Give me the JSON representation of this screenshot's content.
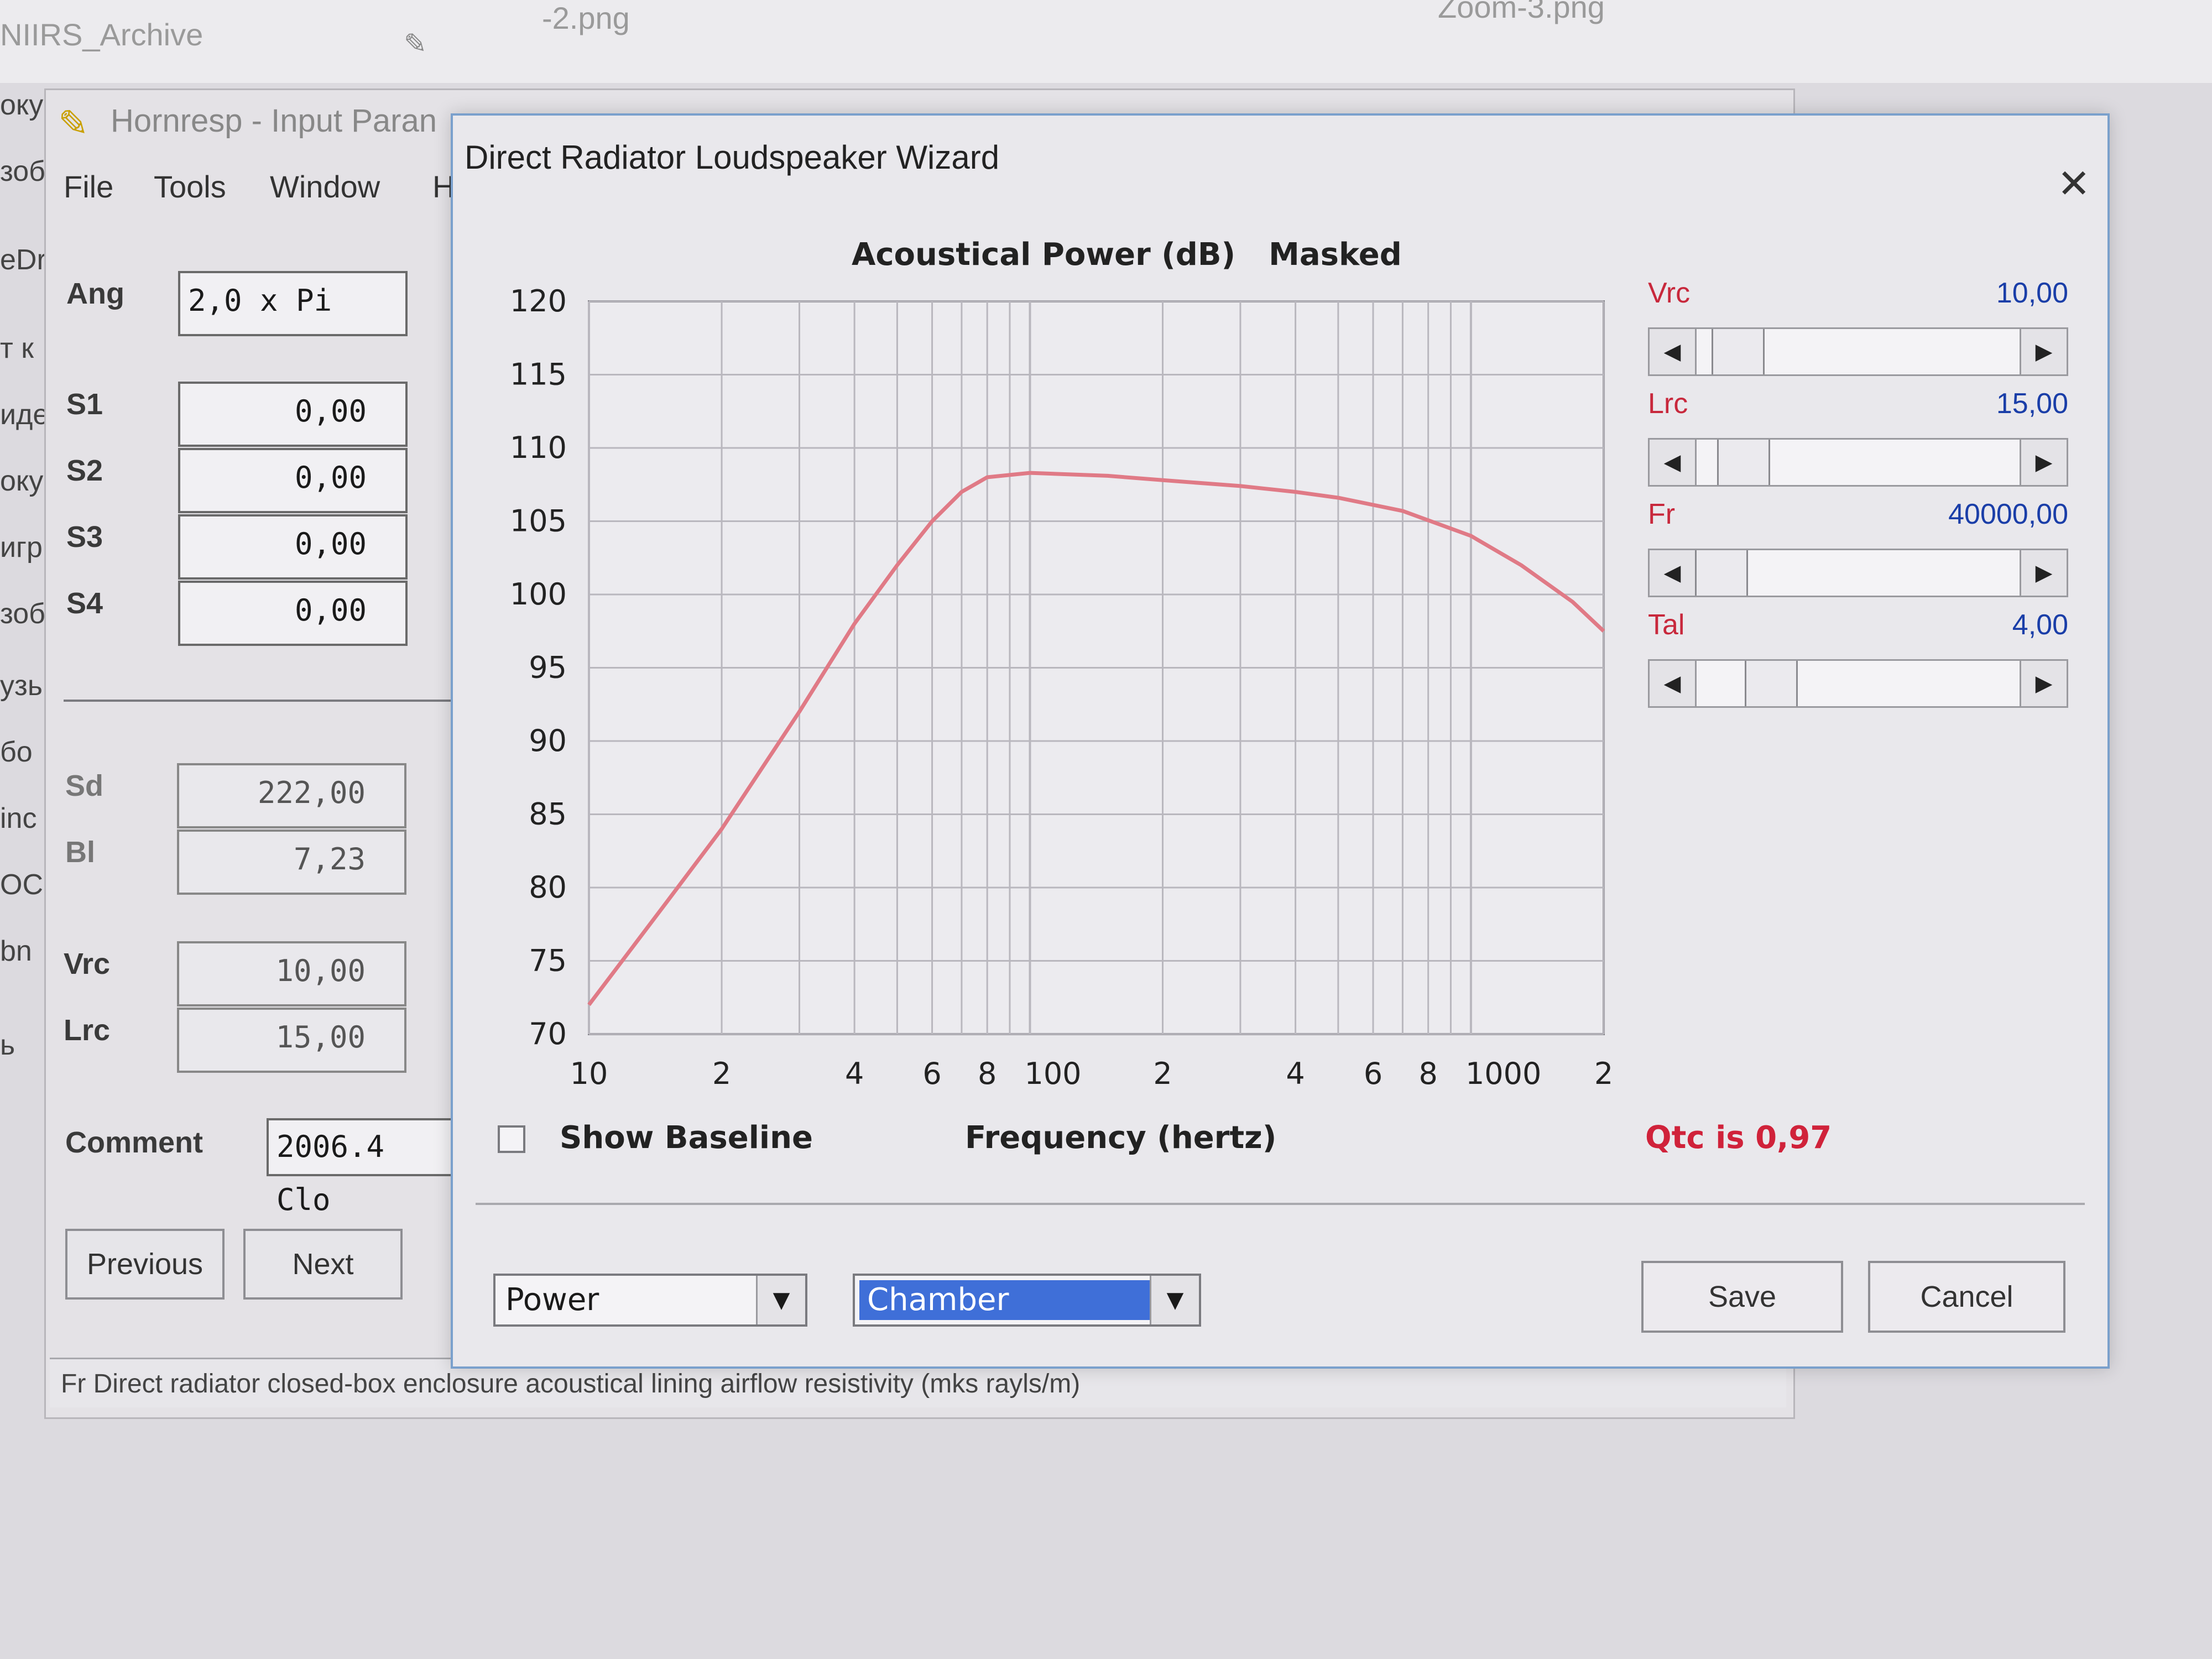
{
  "desktop": {
    "item1": "NIIRS_Archive",
    "item2": "-2.png",
    "item3": "Zoom-3.png"
  },
  "edge_fragments": [
    "оку",
    "зоб",
    "eDr",
    "т к",
    "иде",
    "оку",
    "игр",
    "зоб",
    "узь",
    "бо",
    "inc",
    "ОС",
    "bn",
    "ь"
  ],
  "hornresp": {
    "title": "Hornresp - Input Paran",
    "menu": [
      "File",
      "Tools",
      "Window",
      "H"
    ],
    "fields": [
      {
        "label": "Ang",
        "value": "2,0 x Pi"
      },
      {
        "label": "S1",
        "value": "0,00"
      },
      {
        "label": "S2",
        "value": "0,00"
      },
      {
        "label": "S3",
        "value": "0,00"
      },
      {
        "label": "S4",
        "value": "0,00"
      },
      {
        "label": "Sd",
        "value": "222,00"
      },
      {
        "label": "Bl",
        "value": "7,23"
      },
      {
        "label": "Vrc",
        "value": "10,00"
      },
      {
        "label": "Lrc",
        "value": "15,00"
      }
    ],
    "comment_label": "Comment",
    "comment_value": "2006.4 Clo",
    "prev_label": "Previous",
    "next_label": "Next",
    "status": "Fr  Direct radiator closed-box enclosure acoustical lining airflow resistivity (mks rayls/m)"
  },
  "wizard": {
    "title": "Direct Radiator Loudspeaker Wizard",
    "close": "✕",
    "chart_heading_a": "Acoustical Power (dB)",
    "chart_heading_b": "Masked",
    "sliders": [
      {
        "name": "Vrc",
        "value": "10,00",
        "position": 0.06
      },
      {
        "name": "Lrc",
        "value": "15,00",
        "position": 0.08
      },
      {
        "name": "Fr",
        "value": "40000,00",
        "position": 0.0
      },
      {
        "name": "Tal",
        "value": "4,00",
        "position": 0.18
      }
    ],
    "show_baseline": "Show Baseline",
    "qtc": "Qtc is 0,97",
    "combo_mode": "Power",
    "combo_chamber": "Chamber",
    "save_label": "Save",
    "cancel_label": "Cancel"
  },
  "chart_data": {
    "type": "line",
    "title": "Acoustical Power (dB)   Masked",
    "xlabel": "Frequency (hertz)",
    "ylabel": "",
    "xscale": "log",
    "xlim": [
      10,
      2000
    ],
    "ylim": [
      70,
      120
    ],
    "yticks": [
      "120",
      "115",
      "110",
      "105",
      "100",
      "95",
      "90",
      "85",
      "80",
      "75",
      "70"
    ],
    "xticks": [
      "10",
      "2",
      "4",
      "6",
      "8",
      "100",
      "2",
      "4",
      "6",
      "8",
      "1000",
      "2"
    ],
    "grid": true,
    "series": [
      {
        "color": "#e07a86",
        "x": [
          10,
          15,
          20,
          30,
          40,
          50,
          60,
          70,
          80,
          100,
          150,
          200,
          300,
          400,
          500,
          700,
          1000,
          1300,
          1700,
          2000
        ],
        "y": [
          72,
          79,
          84,
          92,
          98,
          102,
          105,
          107,
          108,
          108.3,
          108.1,
          107.8,
          107.4,
          107.0,
          106.6,
          105.7,
          104.0,
          102.0,
          99.5,
          97.5
        ]
      }
    ]
  }
}
